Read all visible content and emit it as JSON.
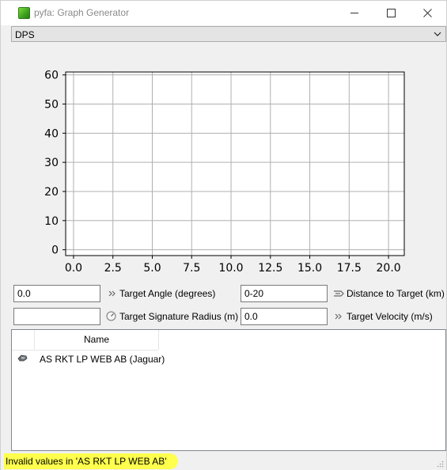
{
  "window": {
    "title": "pyfa: Graph Generator"
  },
  "graph_select": {
    "value": "DPS"
  },
  "chart_data": {
    "type": "line",
    "x": [],
    "series": [],
    "xlim": [
      -0.5,
      21.0
    ],
    "ylim": [
      -2,
      61
    ],
    "xticks": [
      "0.0",
      "2.5",
      "5.0",
      "7.5",
      "10.0",
      "12.5",
      "15.0",
      "17.5",
      "20.0"
    ],
    "xtick_values": [
      0,
      2.5,
      5,
      7.5,
      10,
      12.5,
      15,
      17.5,
      20
    ],
    "yticks": [
      "0",
      "10",
      "20",
      "30",
      "40",
      "50",
      "60"
    ],
    "ytick_values": [
      0,
      10,
      20,
      30,
      40,
      50,
      60
    ],
    "grid": true
  },
  "inputs": {
    "target_angle_value": "0.0",
    "target_angle_label": "Target Angle (degrees)",
    "distance_value": "0-20",
    "distance_label": "Distance to Target (km)",
    "sig_radius_value": "",
    "sig_radius_label": "Target Signature Radius (m)",
    "velocity_value": "0.0",
    "velocity_label": "Target Velocity (m/s)"
  },
  "fit_list": {
    "column_name": "Name",
    "rows": [
      {
        "name": "AS RKT LP WEB AB (Jaguar)",
        "icon": "ship-icon"
      }
    ]
  },
  "status": {
    "text": "Invalid values in 'AS RKT LP WEB AB'"
  }
}
